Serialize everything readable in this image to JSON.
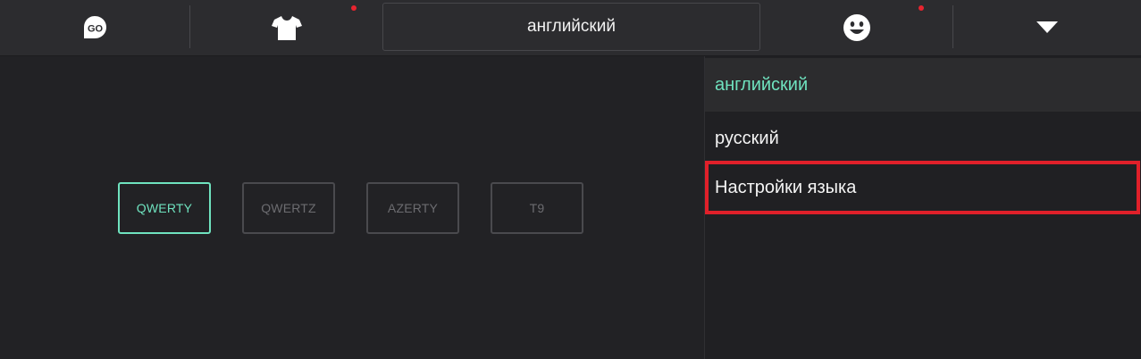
{
  "toolbar": {
    "go_icon_label": "GO",
    "language_selector": "английский",
    "icons": [
      "go-logo-icon",
      "tshirt-icon",
      "smiley-icon",
      "dropdown-triangle-icon"
    ],
    "notification_color": "#e8242f"
  },
  "layouts": {
    "items": [
      {
        "label": "QWERTY",
        "active": true
      },
      {
        "label": "QWERTZ",
        "active": false
      },
      {
        "label": "AZERTY",
        "active": false
      },
      {
        "label": "T9",
        "active": false
      }
    ],
    "accent_color": "#6fe3bf"
  },
  "dropdown": {
    "items": [
      {
        "label": "английский",
        "selected": true
      },
      {
        "label": "русский",
        "selected": false
      },
      {
        "label": "Настройки языка",
        "selected": false,
        "highlighted": true
      }
    ],
    "highlight_color": "#e0202a"
  }
}
